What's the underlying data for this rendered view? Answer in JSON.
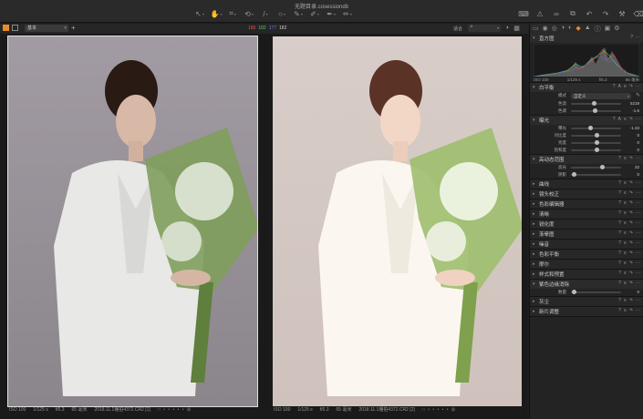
{
  "window": {
    "title": "无题目录.cosessiondb"
  },
  "toolbar": {
    "tools": [
      {
        "name": "cursor-tool",
        "glyph": "↖",
        "active": false
      },
      {
        "name": "pan-tool",
        "glyph": "✋",
        "active": true
      },
      {
        "name": "crop-tool",
        "glyph": "⌗",
        "active": false
      },
      {
        "name": "rotate-tool",
        "glyph": "⟲",
        "active": false
      },
      {
        "name": "keystone-tool",
        "glyph": "/",
        "active": false
      },
      {
        "name": "spot-tool",
        "glyph": "○",
        "active": false
      },
      {
        "name": "brush-tool",
        "glyph": "✎",
        "active": false
      },
      {
        "name": "eraser-tool",
        "glyph": "✐",
        "active": false
      },
      {
        "name": "picker-tool",
        "glyph": "✒",
        "active": false
      },
      {
        "name": "annotate-tool",
        "glyph": "✏",
        "active": false
      }
    ],
    "right_tools": [
      "keyboard-icon",
      "warning-icon",
      "glasses-icon",
      "copy-icon",
      "undo-icon",
      "redo-icon",
      "wrench-icon",
      "brush-clean-icon"
    ]
  },
  "viewbar": {
    "preset": "基本",
    "add": "+",
    "rgb": {
      "r": "186",
      "g": "182",
      "b": "177",
      "l": "182"
    },
    "fit": "适合"
  },
  "photos": [
    {
      "iso": "ISO 100",
      "shutter": "1/125 s",
      "aperture": "f/6.3",
      "focal": "65 毫米",
      "filename": "2018.11.1棚拍4372.CR2 [1]",
      "treatment": "original"
    },
    {
      "iso": "ISO 100",
      "shutter": "1/125 s",
      "aperture": "f/6.3",
      "focal": "65 毫米",
      "filename": "2018.11.1棚拍4372.CR2 [2]",
      "treatment": "edited"
    }
  ],
  "panel": {
    "histogram": {
      "title": "直方图",
      "iso": "ISO 100",
      "shutter": "1/125 s",
      "aperture": "f/6.3",
      "focal": "65 毫米"
    },
    "white_balance": {
      "title": "白平衡",
      "mode_label": "模式",
      "mode_value": "自定义",
      "rows": [
        {
          "label": "色温",
          "value": "5219",
          "pos": 0.45
        },
        {
          "label": "色调",
          "value": "-1.6",
          "pos": 0.48
        }
      ]
    },
    "exposure": {
      "title": "曝光",
      "rows": [
        {
          "label": "曝光",
          "value": "-1.33",
          "pos": 0.38
        },
        {
          "label": "对比度",
          "value": "0",
          "pos": 0.5
        },
        {
          "label": "亮度",
          "value": "0",
          "pos": 0.5
        },
        {
          "label": "饱和度",
          "value": "0",
          "pos": 0.5
        }
      ]
    },
    "hdr": {
      "title": "高动态范围",
      "rows": [
        {
          "label": "高光",
          "value": "32",
          "pos": 0.62
        },
        {
          "label": "阴影",
          "value": "0",
          "pos": 0.05
        }
      ]
    },
    "collapsed": [
      "曲线",
      "镜头校正",
      "色彩编辑器",
      "清晰",
      "锐化度",
      "渐晕图",
      "噪音",
      "色彩平衡",
      "摩尔",
      "样式和预置"
    ],
    "purple_fringe": {
      "title": "紫色边缘消除",
      "rows": [
        {
          "label": "数量",
          "value": "0",
          "pos": 0.05
        }
      ]
    },
    "bottom_collapsed": [
      "灰尘",
      "新片调整"
    ]
  }
}
